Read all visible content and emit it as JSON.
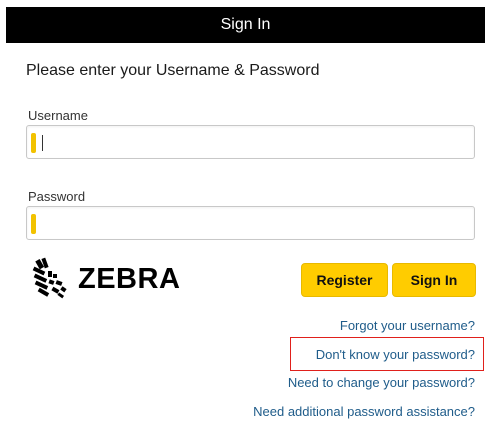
{
  "header": {
    "title": "Sign In"
  },
  "form": {
    "prompt": "Please enter your Username & Password",
    "username": {
      "label": "Username",
      "value": "",
      "placeholder": ""
    },
    "password": {
      "label": "Password",
      "value": "",
      "placeholder": ""
    }
  },
  "logo": {
    "brand_text": "ZEBRA",
    "icon": "zebra-head-logo"
  },
  "buttons": {
    "register_label": "Register",
    "signin_label": "Sign In"
  },
  "links": {
    "forgot_username": "Forgot your username?",
    "dont_know_password": "Don't know your password?",
    "change_password": "Need to change your password?",
    "additional_assistance": "Need additional password assistance?"
  },
  "colors": {
    "header_bg": "#000000",
    "button_yellow": "#ffcc00",
    "field_accent": "#f2c200",
    "link_blue": "#1f5c8a",
    "highlight_red": "#e0201b"
  }
}
